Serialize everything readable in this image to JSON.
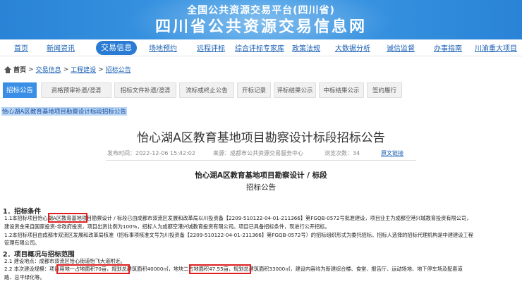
{
  "header": {
    "subtitle": "全国公共资源交易平台(四川省)",
    "title": "四川省公共资源交易信息网"
  },
  "nav": {
    "items": [
      "首页",
      "新闻资讯",
      "交易信息",
      "场地预约",
      "远程评标",
      "综合评标专家库",
      "政策法规",
      "大数据分析",
      "诚信监督",
      "办事指南",
      "川渝重大项目"
    ],
    "active": "交易信息"
  },
  "breadcrumb": {
    "home": "首页",
    "sep": ">",
    "items": [
      "交易信息",
      "工程建设",
      "招标公告"
    ]
  },
  "tabs": [
    "招标公告",
    "资格预审补遗/澄清",
    "招标文件补遗/澄清",
    "流标或终止公告",
    "开标记录",
    "评标结果公示",
    "中标结果公示",
    "签约履行"
  ],
  "highlight_link": "怡心湖A区教育基地项目勘察设计标段招标公告",
  "article": {
    "title": "怡心湖A区教育基地项目勘察设计标段招标公告",
    "published": "发布时间：2022-12-06 15:42:02",
    "source": "来源：成都市公共资源交易服务中心",
    "views": "浏览次数：34",
    "original_link": "原文链接",
    "doc_title": "怡心湖A区教育基地项目勘察设计 / 标段",
    "doc_subtitle": "招标公告"
  },
  "body": {
    "sec1": "1．招标条件",
    "p1_1": "1.1本招标项目怡心湖A区教育基地项目勘察设计 / 标段已由成都市双流区发展和改革局以川投资备【2209-510122-04-01-211366】第FGQB-0572号批准建设，项目业主为成都空港兴城教育投资有限公司，",
    "p1_2": "建设资金来自国家投资-非政府投资，项目出资比例为100%，招标人为成都空港兴城教育投资有限公司。项目已具备招标条件，现进行公开招标。",
    "p1_3": "1.2本招标项目由成都市双流区发展和改革局核准（招标事项核准文号为川投资备【2209-510122-04-01-211366】第FGQB-0572号）的招标组织形式为委托招标。招标人选择的招标代理机构是中建建设工程",
    "p1_4": "管理有限公司。",
    "sec2": "2．项目概况与招标范围",
    "p2_1": "2.1 建设地点：成都市双流区怡心街道怡飞大道附近。",
    "p2_2": "2.2 本次建设规模：项目用地一占地面积70亩，规划总建筑面积40000㎡，地块二占地面积47.55亩，规划总建筑面积33000㎡，建设内容均为新建综合楼、食堂、报告厅、运动场地、地下停车场及配套道",
    "p2_3": "路、总平绿化等。"
  }
}
